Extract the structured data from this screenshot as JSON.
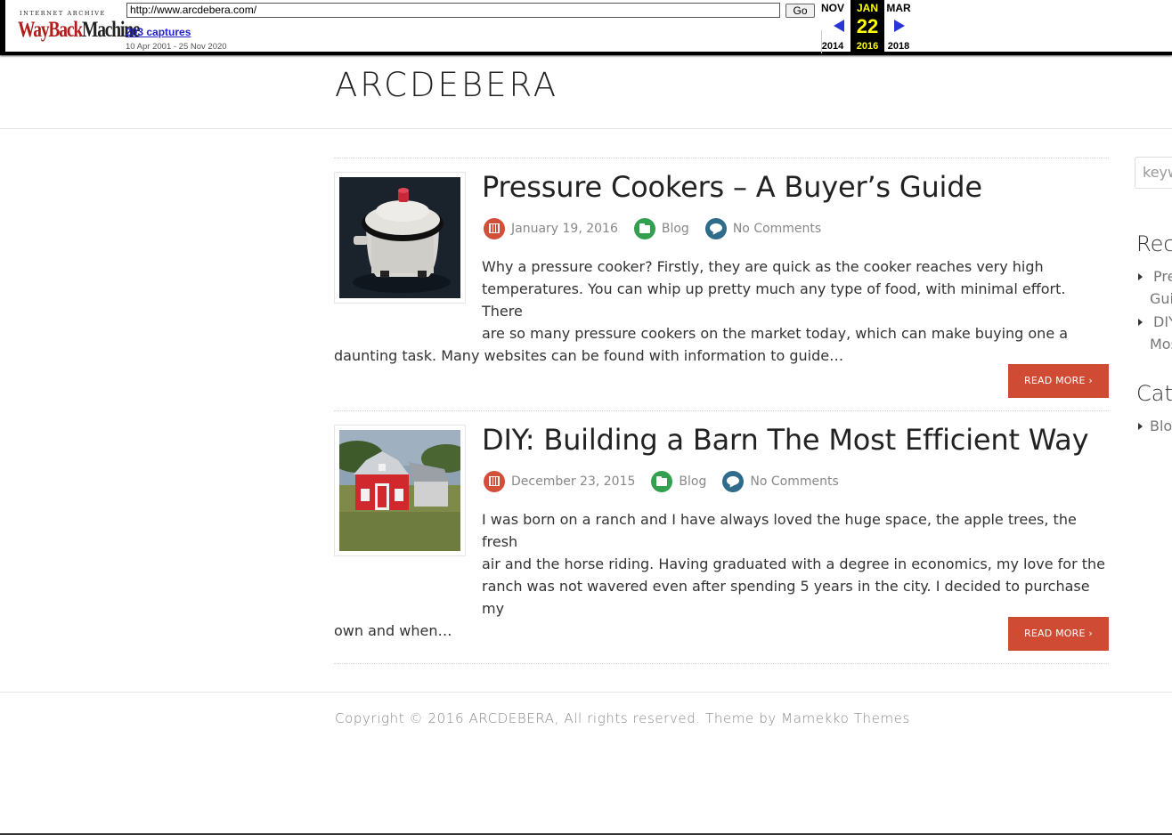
{
  "wayback": {
    "logo_top": "INTERNET ARCHIVE",
    "logo_way": "WayBack",
    "logo_machine": "Machine",
    "url": "http://www.arcdebera.com/",
    "go_label": "Go",
    "captures": "203 captures",
    "range": "10 Apr 2001 - 25 Nov 2020",
    "prev": {
      "month": "NOV",
      "year": "2014"
    },
    "current": {
      "month": "JAN",
      "day": "22",
      "year": "2016"
    },
    "next": {
      "month": "MAR",
      "year": "2018"
    },
    "colors": {
      "current_bg": "#000000",
      "current_fg": "#ffff00",
      "arrow": "#2a36d6"
    }
  },
  "site": {
    "title": "ARCDEBERA"
  },
  "posts": [
    {
      "title": "Pressure Cookers – A Buyer’s Guide",
      "date": "January 19, 2016",
      "category": "Blog",
      "comments": "No Comments",
      "excerpt_lines": [
        "Why a pressure cooker? Firstly, they are quick as the cooker reaches very high",
        "temperatures. You can whip up pretty much any type of food, with minimal effort. There",
        "are so many pressure cookers on the market today, which can make buying one a",
        "daunting task. Many websites can be found with information to guide…"
      ],
      "read_more": "READ MORE ›"
    },
    {
      "title": "DIY: Building a Barn The Most Efficient Way",
      "date": "December 23, 2015",
      "category": "Blog",
      "comments": "No Comments",
      "excerpt_lines": [
        "I was born on a ranch and I have always loved the huge space, the apple trees, the fresh",
        "air and the horse riding. Having graduated with a degree in economics, my love for the",
        "ranch was not wavered even after spending 5 years in the city. I decided to purchase my",
        "own and when…"
      ],
      "read_more": "READ MORE ›"
    }
  ],
  "sidebar": {
    "search_placeholder": "keyw",
    "recent_heading": "Rec",
    "recent_items": [
      [
        "Pre",
        "Gui"
      ],
      [
        "DIY",
        "Mos"
      ]
    ],
    "categories_heading": "Cat",
    "category_items": [
      "Blo"
    ]
  },
  "footer": {
    "text": "Copyright © 2016 ARCDEBERA, All rights reserved. Theme by Mamekko Themes"
  },
  "colors": {
    "accent": "#cf4b34",
    "date_icon": "#d2503a",
    "category_icon": "#33a050",
    "comment_icon": "#2f6b8a"
  }
}
